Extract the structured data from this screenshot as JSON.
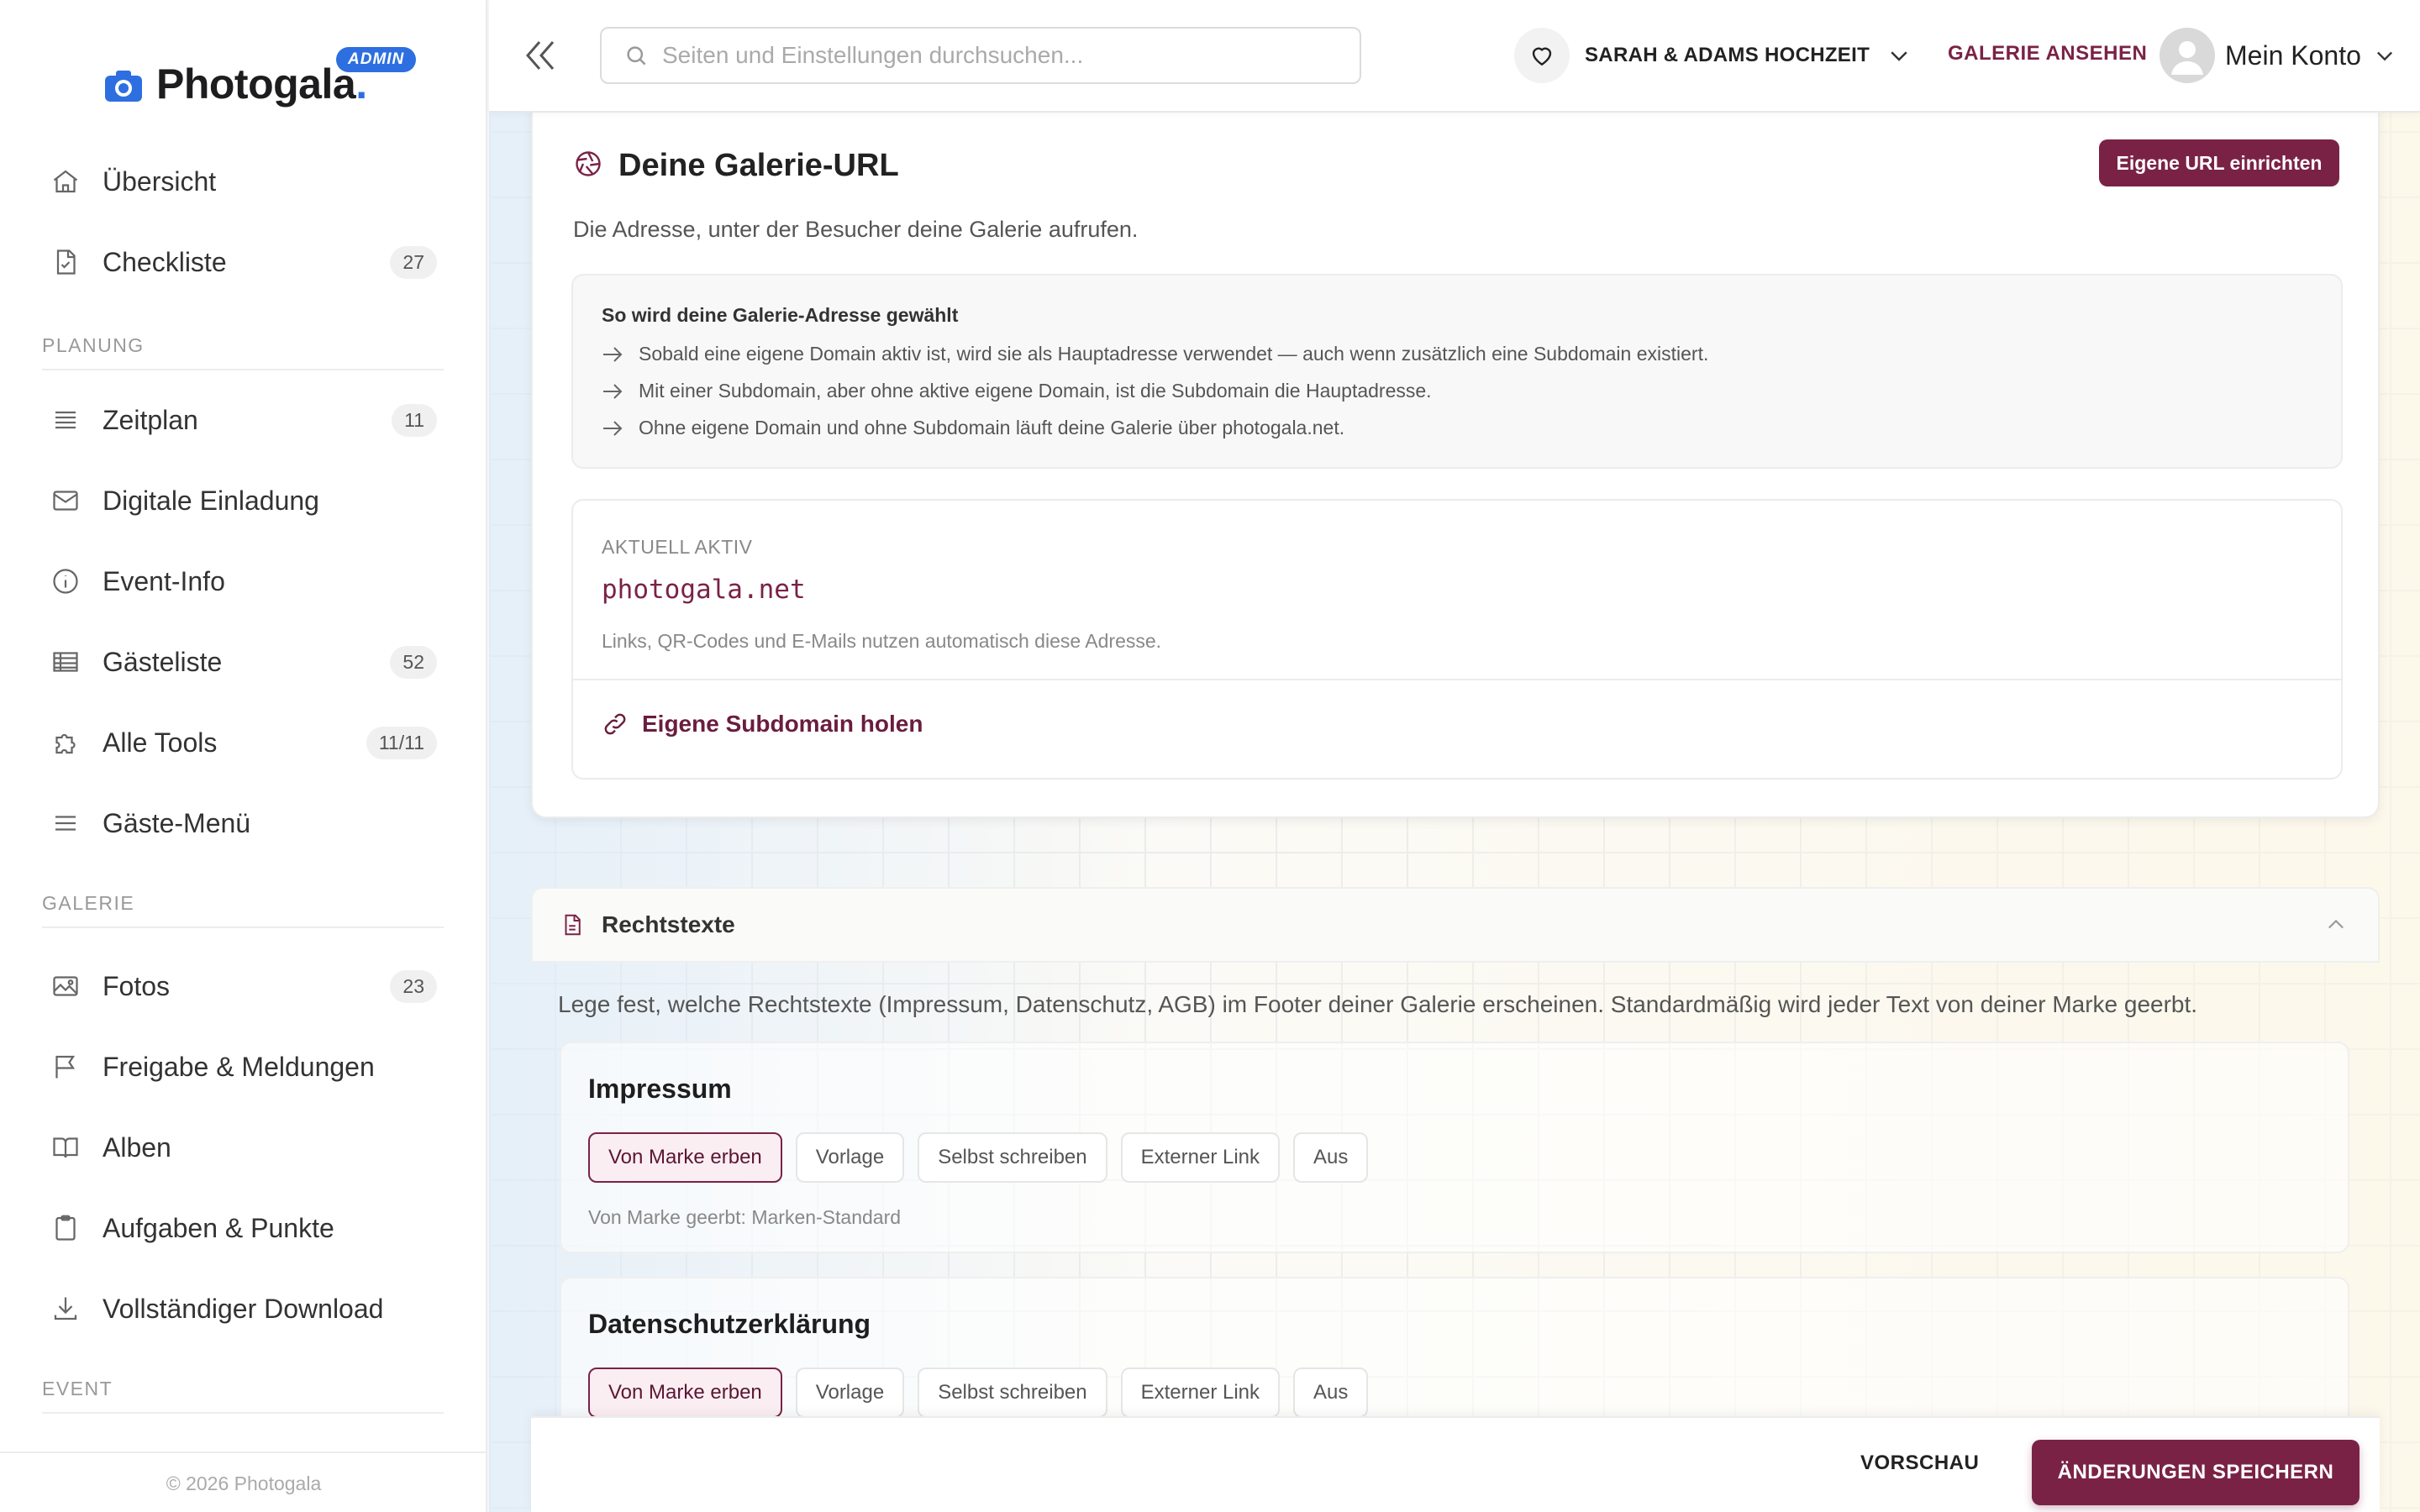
{
  "brand": {
    "name": "Photogala",
    "dot": ".",
    "badge": "ADMIN"
  },
  "sidebar": {
    "items": [
      {
        "label": "Übersicht",
        "icon": "home-icon"
      },
      {
        "label": "Checkliste",
        "icon": "checklist-icon",
        "count": "27"
      },
      {
        "label": "Zeitplan",
        "icon": "timeline-icon",
        "count": "11"
      },
      {
        "label": "Digitale Einladung",
        "icon": "mail-icon"
      },
      {
        "label": "Event-Info",
        "icon": "info-icon"
      },
      {
        "label": "Gästeliste",
        "icon": "table-icon",
        "count": "52"
      },
      {
        "label": "Alle Tools",
        "icon": "puzzle-icon",
        "count": "11/11"
      },
      {
        "label": "Gäste-Menü",
        "icon": "menu-icon"
      },
      {
        "label": "Fotos",
        "icon": "image-icon",
        "count": "23"
      },
      {
        "label": "Freigabe & Meldungen",
        "icon": "flag-icon"
      },
      {
        "label": "Alben",
        "icon": "book-icon"
      },
      {
        "label": "Aufgaben & Punkte",
        "icon": "clipboard-icon"
      },
      {
        "label": "Vollständiger Download",
        "icon": "download-icon"
      }
    ],
    "sections": {
      "planung": "PLANUNG",
      "galerie": "GALERIE",
      "event": "EVENT"
    },
    "copyright": "© 2026 Photogala"
  },
  "topbar": {
    "search_placeholder": "Seiten und Einstellungen durchsuchen...",
    "event_name": "SARAH & ADAMS HOCHZEIT",
    "gallery_link": "GALERIE ANSEHEN",
    "account_label": "Mein Konto"
  },
  "url_card": {
    "title": "Deine Galerie-URL",
    "button": "Eigene URL einrichten",
    "subtitle": "Die Adresse, unter der Besucher deine Galerie aufrufen.",
    "info_title": "So wird deine Galerie-Adresse gewählt",
    "info_rows": [
      "Sobald eine eigene Domain aktiv ist, wird sie als Hauptadresse verwendet — auch wenn zusätzlich eine Subdomain existiert.",
      "Mit einer Subdomain, aber ohne aktive eigene Domain, ist die Subdomain die Hauptadresse.",
      "Ohne eigene Domain und ohne Subdomain läuft deine Galerie über photogala.net."
    ],
    "active_label": "AKTUELL AKTIV",
    "active_domain": "photogala.net",
    "active_note": "Links, QR-Codes und E-Mails nutzen automatisch diese Adresse.",
    "subdomain_link": "Eigene Subdomain holen"
  },
  "legal": {
    "title": "Rechtstexte",
    "description": "Lege fest, welche Rechtstexte (Impressum, Datenschutz, AGB) im Footer deiner Galerie erscheinen. Standardmäßig wird jeder Text von deiner Marke geerbt.",
    "options": [
      "Von Marke erben",
      "Vorlage",
      "Selbst schreiben",
      "Externer Link",
      "Aus"
    ],
    "blocks": [
      {
        "title": "Impressum",
        "selected": "Von Marke erben",
        "hint": "Von Marke geerbt: Marken-Standard"
      },
      {
        "title": "Datenschutzerklärung",
        "selected": "Von Marke erben"
      }
    ]
  },
  "actions": {
    "preview": "VORSCHAU",
    "save": "ÄNDERUNGEN SPEICHERN"
  },
  "colors": {
    "accent": "#7a2246",
    "brand_blue": "#2d6fe0"
  }
}
